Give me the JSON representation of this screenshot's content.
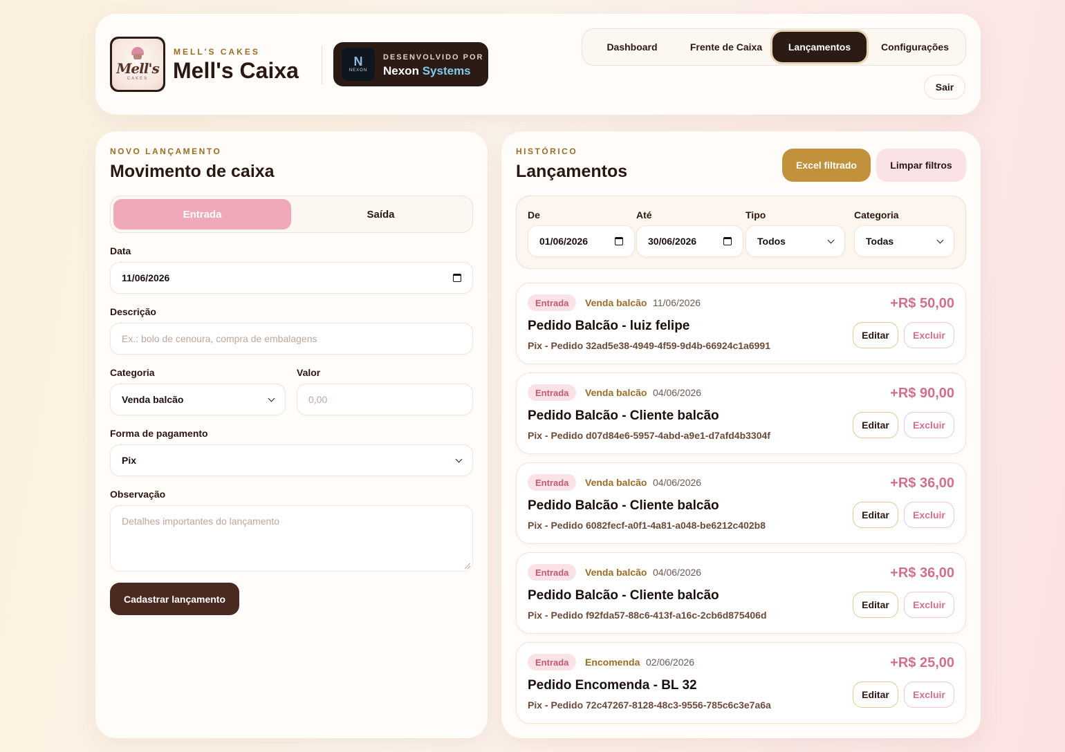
{
  "header": {
    "brand_kicker": "MELL'S CAKES",
    "brand_title": "Mell's Caixa",
    "logo_text": "Mell's",
    "logo_sub": "CAKES",
    "dev_kicker": "DESENVOLVIDO POR",
    "dev_name": "Nexon",
    "dev_name_accent": "Systems",
    "dev_logo_letter": "N",
    "dev_logo_word": "NEXON",
    "nav": [
      {
        "label": "Dashboard",
        "active": false
      },
      {
        "label": "Frente de Caixa",
        "active": false
      },
      {
        "label": "Lançamentos",
        "active": true
      },
      {
        "label": "Configurações",
        "active": false
      }
    ],
    "logout_label": "Sair"
  },
  "form": {
    "kicker": "NOVO LANÇAMENTO",
    "title": "Movimento de caixa",
    "type_entrada": "Entrada",
    "type_saida": "Saída",
    "selected_type": "Entrada",
    "date_label": "Data",
    "date_value": "11/06/2026",
    "desc_label": "Descrição",
    "desc_placeholder": "Ex.: bolo de cenoura, compra de embalagens",
    "category_label": "Categoria",
    "category_value": "Venda balcão",
    "value_label": "Valor",
    "value_placeholder": "0,00",
    "payment_label": "Forma de pagamento",
    "payment_value": "Pix",
    "note_label": "Observação",
    "note_placeholder": "Detalhes importantes do lançamento",
    "submit_label": "Cadastrar lançamento"
  },
  "history": {
    "kicker": "HISTÓRICO",
    "title": "Lançamentos",
    "excel_label": "Excel filtrado",
    "clear_label": "Limpar filtros",
    "filters": {
      "from_label": "De",
      "from_value": "01/06/2026",
      "to_label": "Até",
      "to_value": "30/06/2026",
      "type_label": "Tipo",
      "type_value": "Todos",
      "category_label": "Categoria",
      "category_value": "Todas"
    },
    "edit_label": "Editar",
    "delete_label": "Excluir",
    "entries": [
      {
        "tag": "Entrada",
        "category": "Venda balcão",
        "date": "11/06/2026",
        "amount": "+R$ 50,00",
        "title": "Pedido Balcão - luiz felipe",
        "detail": "Pix - Pedido 32ad5e38-4949-4f59-9d4b-66924c1a6991"
      },
      {
        "tag": "Entrada",
        "category": "Venda balcão",
        "date": "04/06/2026",
        "amount": "+R$ 90,00",
        "title": "Pedido Balcão - Cliente balcão",
        "detail": "Pix - Pedido d07d84e6-5957-4abd-a9e1-d7afd4b3304f"
      },
      {
        "tag": "Entrada",
        "category": "Venda balcão",
        "date": "04/06/2026",
        "amount": "+R$ 36,00",
        "title": "Pedido Balcão - Cliente balcão",
        "detail": "Pix - Pedido 6082fecf-a0f1-4a81-a048-be6212c402b8"
      },
      {
        "tag": "Entrada",
        "category": "Venda balcão",
        "date": "04/06/2026",
        "amount": "+R$ 36,00",
        "title": "Pedido Balcão - Cliente balcão",
        "detail": "Pix - Pedido f92fda57-88c6-413f-a16c-2cb6d875406d"
      },
      {
        "tag": "Entrada",
        "category": "Encomenda",
        "date": "02/06/2026",
        "amount": "+R$ 25,00",
        "title": "Pedido Encomenda - BL 32",
        "detail": "Pix - Pedido 72c47267-8128-48c3-9556-785c6c3e7a6a"
      }
    ]
  },
  "colors": {
    "accent_gold": "#c2913c",
    "accent_pink": "#f0a9b8",
    "dark_brown": "#2b1b14",
    "amount_pink": "#d0708e"
  }
}
